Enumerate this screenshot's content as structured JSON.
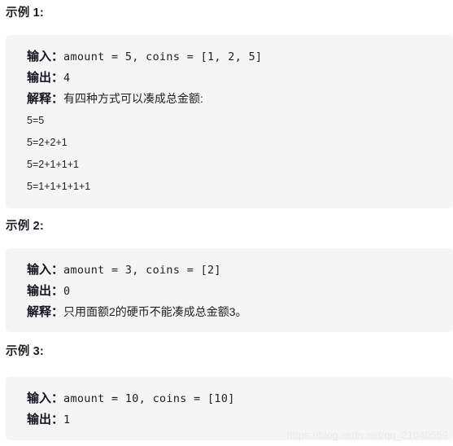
{
  "document": {
    "background_color": "#ffffff",
    "code_block_color": "#f5f5f5",
    "text_color": "#1b1f23"
  },
  "examples": [
    {
      "heading": "示例 1:",
      "input_label": "输入：",
      "input_value": "amount = 5, coins = [1, 2, 5]",
      "output_label": "输出：",
      "output_value": "4",
      "explanation_label": "解释：",
      "explanation_value": "有四种方式可以凑成总金额:",
      "equations": [
        "5=5",
        "5=2+2+1",
        "5=2+1+1+1",
        "5=1+1+1+1+1"
      ]
    },
    {
      "heading": "示例 2:",
      "input_label": "输入：",
      "input_value": "amount = 3, coins = [2]",
      "output_label": "输出：",
      "output_value": "0",
      "explanation_label": "解释：",
      "explanation_value": "只用面额2的硬币不能凑成总金额3。",
      "equations": []
    },
    {
      "heading": "示例 3:",
      "input_label": "输入：",
      "input_value": "amount = 10, coins = [10]",
      "output_label": "输出：",
      "output_value": "1",
      "explanation_label": "",
      "explanation_value": "",
      "equations": []
    }
  ],
  "watermark": {
    "text": "https://blog.csdn.net/qq_21040559",
    "color": "#e9e9e9"
  }
}
